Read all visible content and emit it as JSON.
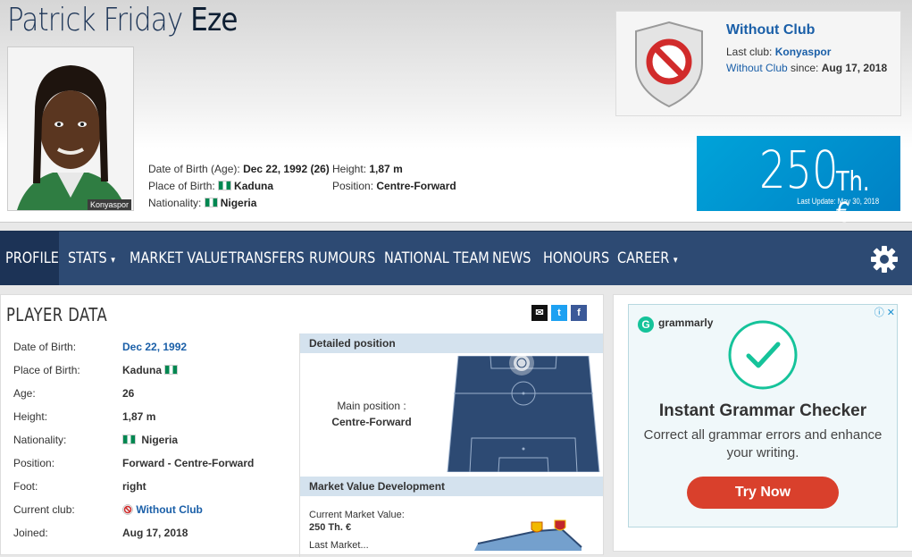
{
  "player": {
    "first_names": "Patrick Friday",
    "last_name": "Eze",
    "photo_caption": "Konyaspor"
  },
  "header_info": {
    "dob_label": "Date of Birth (Age):",
    "dob_value": "Dec 22, 1992 (26)",
    "pob_label": "Place of Birth:",
    "pob_value": "Kaduna",
    "nationality_label": "Nationality:",
    "nationality_value": "Nigeria",
    "height_label": "Height:",
    "height_value": "1,87 m",
    "position_label": "Position:",
    "position_value": "Centre-Forward"
  },
  "club": {
    "title": "Without Club",
    "last_club_label": "Last club:",
    "last_club_value": "Konyaspor",
    "since_link": "Without Club",
    "since_label": "since:",
    "since_value": "Aug 17, 2018"
  },
  "market_value": {
    "value": "250",
    "unit": "Th. €",
    "last_update": "Last Update: May 30, 2018"
  },
  "nav": {
    "items": [
      "PROFILE",
      "STATS",
      "MARKET VALUE",
      "TRANSFERS",
      "RUMOURS",
      "NATIONAL TEAM",
      "NEWS",
      "HONOURS",
      "CAREER"
    ],
    "active": "PROFILE"
  },
  "player_data": {
    "title": "PLAYER DATA",
    "share": [
      "✉",
      "t",
      "f"
    ],
    "rows": [
      {
        "label": "Date of Birth:",
        "value": "Dec 22, 1992"
      },
      {
        "label": "Place of Birth:",
        "value": "Kaduna"
      },
      {
        "label": "Age:",
        "value": "26"
      },
      {
        "label": "Height:",
        "value": "1,87 m"
      },
      {
        "label": "Nationality:",
        "value": "Nigeria"
      },
      {
        "label": "Position:",
        "value": "Forward - Centre-Forward"
      },
      {
        "label": "Foot:",
        "value": "right"
      },
      {
        "label": "Current club:",
        "value": "Without Club"
      },
      {
        "label": "Joined:",
        "value": "Aug 17, 2018"
      }
    ]
  },
  "detailed_position": {
    "title": "Detailed position",
    "main_label": "Main position :",
    "main_value": "Centre-Forward"
  },
  "mv_development": {
    "title": "Market Value Development",
    "current_label": "Current Market Value:",
    "current_value": "250 Th. €",
    "last_label": "Last Market..."
  },
  "ad": {
    "brand": "grammarly",
    "title": "Instant Grammar Checker",
    "body": "Correct all grammar errors and enhance your writing.",
    "button": "Try Now"
  },
  "colors": {
    "brand_blue": "#1a5fa8",
    "nav_bg": "#2d4a73",
    "mv_bg": "#0081c5"
  }
}
